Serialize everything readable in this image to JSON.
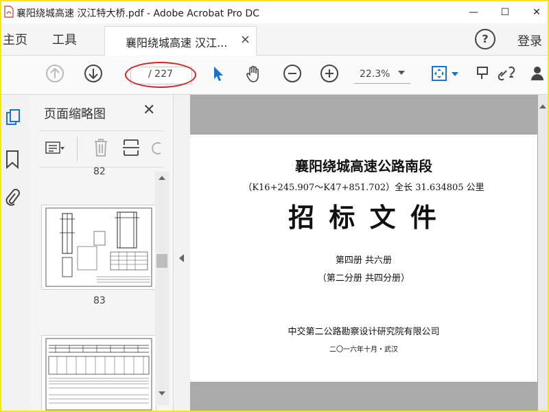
{
  "window": {
    "title": "襄阳绕城高速 汉江特大桥.pdf - Adobe Acrobat Pro DC",
    "minimize_glyph": "—",
    "maximize_glyph": "☐",
    "close_glyph": "✕"
  },
  "tabs": {
    "home": "主页",
    "tools": "工具",
    "document": "襄阳绕城高速 汉江...",
    "document_close": "×",
    "help": "?",
    "signin": "登录"
  },
  "toolbar": {
    "page_current": "",
    "page_total_label": "/ 227",
    "zoom": "22.3%"
  },
  "thumbnails": {
    "title": "页面缩略图",
    "close_glyph": "✕",
    "items": [
      {
        "page": "82"
      },
      {
        "page": "83"
      }
    ]
  },
  "document": {
    "line1": "襄阳绕城高速公路南段",
    "line2": "（K16+245.907～K47+851.702）全长 31.634805 公里",
    "line3": "招  标  文  件",
    "line4": "第四册    共六册",
    "line5": "（第二分册  共四分册）",
    "line6": "中交第二公路勘察设计研究院有限公司",
    "line7": "二〇一六年十月・武汉"
  },
  "colors": {
    "border_highlight": "#f7e70a",
    "annotation_oval": "#d42020",
    "accent_blue": "#1a73c8"
  }
}
